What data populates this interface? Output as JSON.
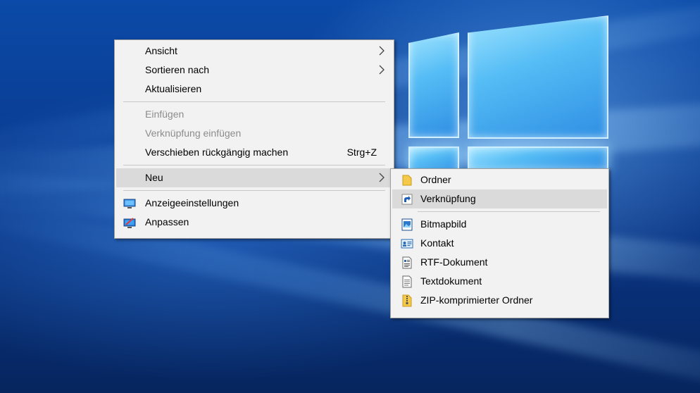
{
  "context_menu": {
    "items": [
      {
        "label": "Ansicht"
      },
      {
        "label": "Sortieren nach"
      },
      {
        "label": "Aktualisieren"
      },
      {
        "label": "Einfügen"
      },
      {
        "label": "Verknüpfung einfügen"
      },
      {
        "label": "Verschieben rückgängig machen",
        "shortcut": "Strg+Z"
      },
      {
        "label": "Neu"
      },
      {
        "label": "Anzeigeeinstellungen",
        "icon": "display-settings-icon"
      },
      {
        "label": "Anpassen",
        "icon": "personalize-icon"
      }
    ]
  },
  "submenu_new": {
    "items": [
      {
        "label": "Ordner",
        "icon": "folder-icon"
      },
      {
        "label": "Verknüpfung",
        "icon": "shortcut-icon"
      },
      {
        "label": "Bitmapbild",
        "icon": "bitmap-icon"
      },
      {
        "label": "Kontakt",
        "icon": "contact-icon"
      },
      {
        "label": "RTF-Dokument",
        "icon": "rtf-document-icon"
      },
      {
        "label": "Textdokument",
        "icon": "text-document-icon"
      },
      {
        "label": "ZIP-komprimierter Ordner",
        "icon": "zip-folder-icon"
      }
    ]
  },
  "colors": {
    "menu_background": "#f2f2f2",
    "highlight": "#dadada",
    "disabled_text": "#8c8c8c",
    "wallpaper_blue": "#0a3d93"
  }
}
